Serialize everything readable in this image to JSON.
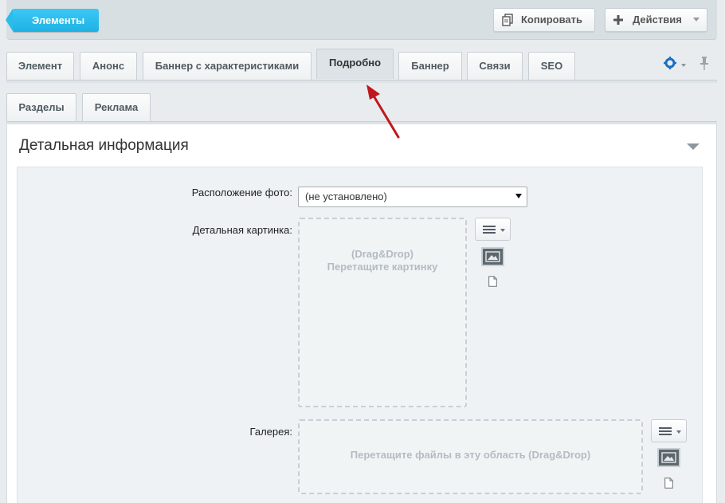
{
  "toolbar": {
    "back_label": "Элементы",
    "copy_label": "Копировать",
    "actions_label": "Действия"
  },
  "tabs_row1": [
    {
      "label": "Элемент"
    },
    {
      "label": "Анонс"
    },
    {
      "label": "Баннер с характеристиками"
    },
    {
      "label": "Подробно",
      "active": true
    },
    {
      "label": "Баннер"
    },
    {
      "label": "Связи"
    },
    {
      "label": "SEO"
    }
  ],
  "tabs_row2": [
    {
      "label": "Разделы"
    },
    {
      "label": "Реклама"
    }
  ],
  "section": {
    "title": "Детальная информация"
  },
  "form": {
    "photo_position_label": "Расположение фото:",
    "photo_position_value": "(не установлено)",
    "detail_picture_label": "Детальная картинка:",
    "detail_drop_line1": "(Drag&Drop)",
    "detail_drop_line2": "Перетащите картинку",
    "gallery_label": "Галерея:",
    "gallery_drop_text": "Перетащите файлы в эту область (Drag&Drop)"
  },
  "icons": {
    "gear": "gear-icon",
    "pin": "pin-icon",
    "copy": "copy-icon",
    "plus": "plus-icon"
  },
  "colors": {
    "accent": "#1eb2e3",
    "annotation_arrow": "#c0171d",
    "gear": "#1b6fc2"
  }
}
